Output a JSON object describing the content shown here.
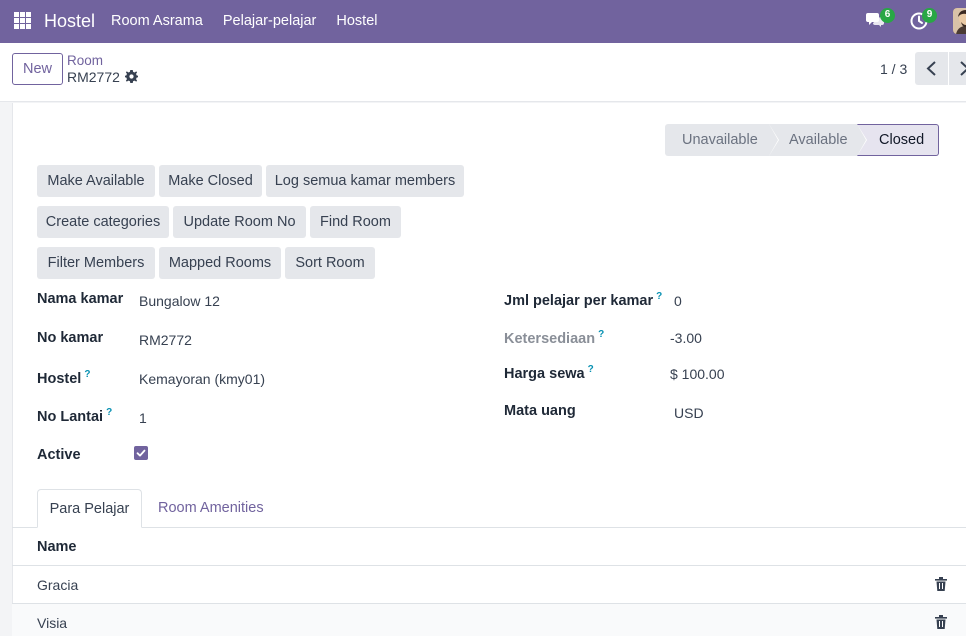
{
  "navbar": {
    "brand": "Hostel",
    "menu": [
      "Room Asrama",
      "Pelajar-pelajar",
      "Hostel"
    ],
    "chat_count": "6",
    "activity_count": "9"
  },
  "control": {
    "new_label": "New",
    "breadcrumb_parent": "Room",
    "breadcrumb_current": "RM2772",
    "pager": "1 / 3"
  },
  "status": {
    "steps": [
      "Unavailable",
      "Available",
      "Closed"
    ],
    "active": "Closed"
  },
  "actions": {
    "row1": [
      "Make Available",
      "Make Closed",
      "Log semua kamar members"
    ],
    "row2": [
      "Create categories",
      "Update Room No",
      "Find Room"
    ],
    "row3": [
      "Filter Members",
      "Mapped Rooms",
      "Sort Room"
    ]
  },
  "form": {
    "left": [
      {
        "label": "Nama kamar",
        "value": "Bungalow 12",
        "help": ""
      },
      {
        "label": "No kamar",
        "value": "RM2772",
        "help": ""
      },
      {
        "label": "Hostel",
        "value": "Kemayoran (kmy01)",
        "help": "?"
      },
      {
        "label": "No Lantai",
        "value": "1",
        "help": "?"
      },
      {
        "label": "Active",
        "value": "",
        "help": ""
      }
    ],
    "right": [
      {
        "label": "Jml pelajar per kamar",
        "value": "0",
        "help": "?"
      },
      {
        "label": "Ketersediaan",
        "value": "-3.00",
        "help": "?"
      },
      {
        "label": "Harga sewa",
        "value": "$ 100.00",
        "help": "?"
      },
      {
        "label": "Mata uang",
        "value": "USD",
        "help": ""
      }
    ],
    "active_checked": true
  },
  "tabs": [
    "Para Pelajar",
    "Room Amenities"
  ],
  "table": {
    "header": "Name",
    "rows": [
      "Gracia",
      "Visia"
    ]
  },
  "colors": {
    "brand": "#71639e",
    "badge": "#28a745"
  }
}
